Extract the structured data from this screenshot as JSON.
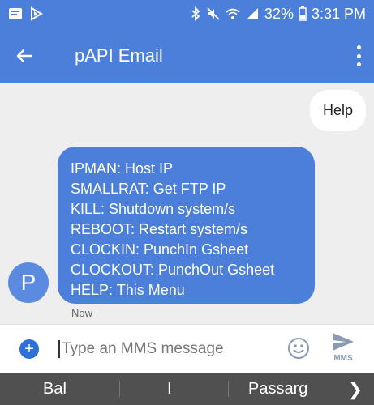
{
  "status": {
    "battery": "32%",
    "time": "3:31 PM"
  },
  "app_bar": {
    "title": "pAPI Email"
  },
  "messages": {
    "outgoing": "Help",
    "incoming": [
      "IPMAN: Host IP",
      "SMALLRAT: Get FTP IP",
      "KILL: Shutdown system/s",
      "REBOOT: Restart system/s",
      "CLOCKIN: PunchIn Gsheet",
      "CLOCKOUT: PunchOut Gsheet",
      "HELP: This Menu"
    ],
    "avatar_letter": "P",
    "timestamp": "Now"
  },
  "compose": {
    "placeholder": "Type an MMS message",
    "send_label": "MMS"
  },
  "suggestions": [
    "Bal",
    "I",
    "Passarg"
  ],
  "colors": {
    "accent": "#4b7fd9",
    "add_button": "#2f6fd8",
    "suggestion_bar": "#505050"
  },
  "icons": [
    "notification-icon",
    "play-store-icon",
    "bluetooth-icon",
    "mute-icon",
    "wifi-icon",
    "signal-icon",
    "battery-icon",
    "back-arrow-icon",
    "overflow-menu-icon",
    "add-icon",
    "emoji-icon",
    "send-icon",
    "chevron-right-icon"
  ]
}
